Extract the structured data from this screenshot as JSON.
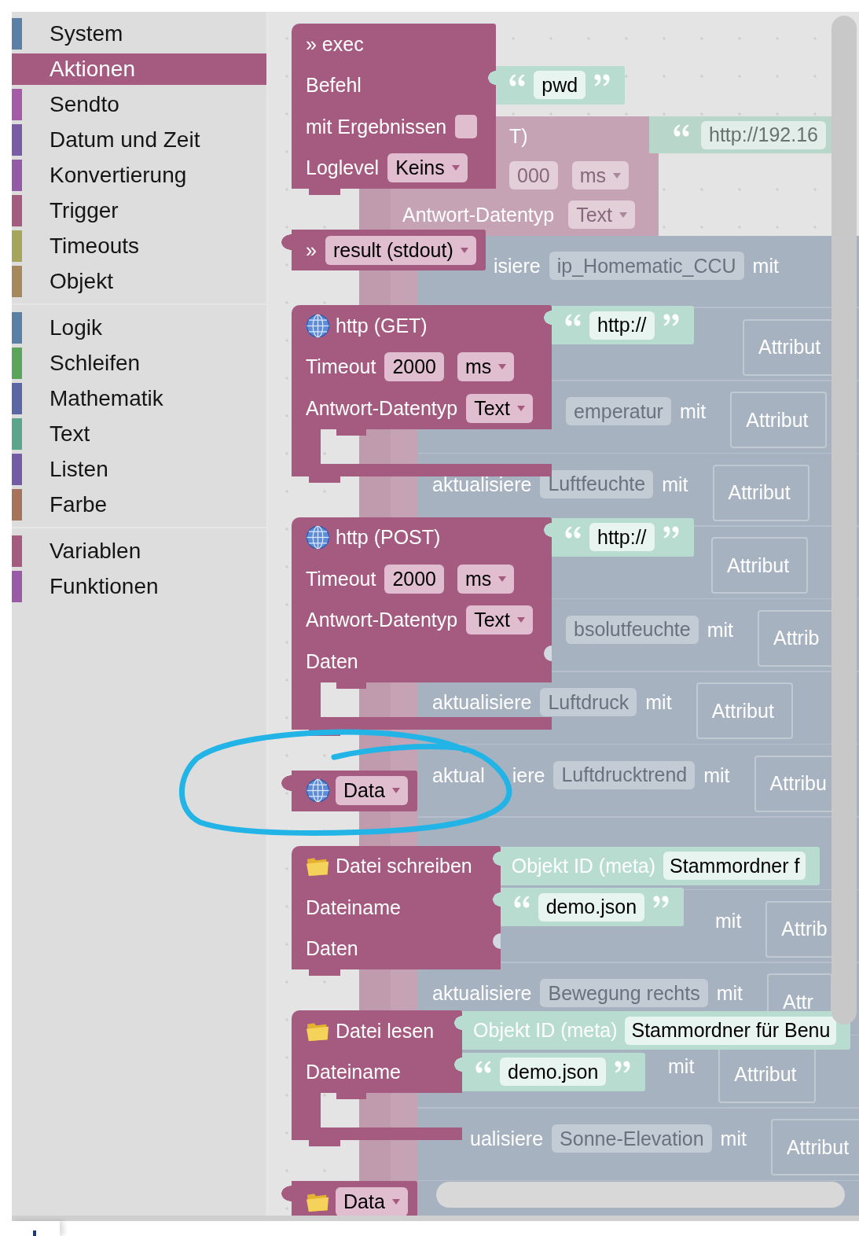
{
  "sidebar": {
    "groups": [
      {
        "items": [
          {
            "label": "System",
            "color": "#5b80a5",
            "selected": false
          },
          {
            "label": "Aktionen",
            "color": "#a55b80",
            "selected": true
          },
          {
            "label": "Sendto",
            "color": "#a55ba5",
            "selected": false
          },
          {
            "label": "Datum und Zeit",
            "color": "#7a5ba5",
            "selected": false
          },
          {
            "label": "Konvertierung",
            "color": "#935ba5",
            "selected": false
          },
          {
            "label": "Trigger",
            "color": "#a55b80",
            "selected": false
          },
          {
            "label": "Timeouts",
            "color": "#a5a55b",
            "selected": false
          },
          {
            "label": "Objekt",
            "color": "#a5885b",
            "selected": false
          }
        ]
      },
      {
        "items": [
          {
            "label": "Logik",
            "color": "#5b80a5",
            "selected": false
          },
          {
            "label": "Schleifen",
            "color": "#5ba55b",
            "selected": false
          },
          {
            "label": "Mathematik",
            "color": "#5b67a5",
            "selected": false
          },
          {
            "label": "Text",
            "color": "#5ba58c",
            "selected": false
          },
          {
            "label": "Listen",
            "color": "#745ba5",
            "selected": false
          },
          {
            "label": "Farbe",
            "color": "#a5745b",
            "selected": false
          }
        ]
      },
      {
        "items": [
          {
            "label": "Variablen",
            "color": "#a55b80",
            "selected": false
          },
          {
            "label": "Funktionen",
            "color": "#995ba5",
            "selected": false
          }
        ]
      }
    ]
  },
  "flyout": {
    "blocks": [
      {
        "kind": "command",
        "statement_input": false,
        "rows": [
          {
            "label": "» exec"
          },
          {
            "label": "Befehl",
            "input": {
              "kind": "text",
              "text": "pwd"
            }
          },
          {
            "label": "mit Ergebnissen",
            "checkbox": {
              "checked": false
            }
          },
          {
            "label": "Loglevel",
            "dropdown": "Keins"
          }
        ]
      },
      {
        "kind": "result",
        "statement_input": false,
        "rows": [
          {
            "label": "»",
            "dropdown": "result (stdout)"
          }
        ]
      },
      {
        "kind": "request",
        "statement_input": true,
        "rows": [
          {
            "label": "http (GET)",
            "input": {
              "kind": "text",
              "text": "http://"
            }
          },
          {
            "label": "Timeout",
            "field": "2000",
            "dropdown": "ms"
          },
          {
            "label": "Antwort-Datentyp",
            "dropdown": "Text"
          }
        ]
      },
      {
        "kind": "request",
        "statement_input": true,
        "rows": [
          {
            "label": "http (POST)",
            "input": {
              "kind": "text",
              "text": "http://"
            }
          },
          {
            "label": "Timeout",
            "field": "2000",
            "dropdown": "ms"
          },
          {
            "label": "Antwort-Datentyp",
            "dropdown": "Text"
          },
          {
            "label": "Daten",
            "input": {
              "kind": "empty"
            }
          }
        ]
      },
      {
        "kind": "response",
        "statement_input": false,
        "rows": [
          {
            "dropdown": "Data"
          }
        ]
      },
      {
        "kind": "file",
        "statement_input": false,
        "rows": [
          {
            "label": "Datei schreiben",
            "input": {
              "kind": "object_id",
              "label": "Objekt ID (meta)",
              "value": "Stammordner f"
            }
          },
          {
            "label": "Dateiname",
            "input": {
              "kind": "text",
              "text": "demo.json"
            }
          },
          {
            "label": "Daten",
            "input": {
              "kind": "empty"
            }
          }
        ]
      },
      {
        "kind": "file",
        "statement_input": true,
        "rows": [
          {
            "label": "Datei lesen",
            "input": {
              "kind": "object_id",
              "label": "Objekt ID (meta)",
              "value": "Stammordner für Benu"
            }
          },
          {
            "label": "Dateiname",
            "input": {
              "kind": "text",
              "text": "demo.json"
            }
          }
        ]
      },
      {
        "kind": "filedata",
        "statement_input": false,
        "rows": [
          {
            "dropdown": "Data"
          }
        ]
      }
    ]
  },
  "workspace": {
    "http_block": {
      "title": "T)",
      "timeout": "000",
      "unit": "ms",
      "type_label": "Antwort-Datentyp",
      "type": "Text",
      "url": "http://192.16"
    },
    "update_blocks": [
      {
        "label": "isiere",
        "object": "ip_Homematic_CCU",
        "connector": "mit"
      },
      {
        "attribute": "Attribut"
      },
      {
        "object": "emperatur",
        "connector": "mit",
        "attribute": "Attribut"
      },
      {
        "label": "aktualisiere",
        "object": "Luftfeuchte",
        "connector": "mit",
        "attribute": "Attribut"
      },
      {
        "attribute": "Attribut"
      },
      {
        "object": "bsolutfeuchte",
        "connector": "mit",
        "attribute": "Attrib"
      },
      {
        "label": "aktualisiere",
        "object": "Luftdruck",
        "connector": "mit",
        "attribute": "Attribut"
      },
      {
        "label_parts": [
          "aktual",
          "iere"
        ],
        "object": "Luftdrucktrend",
        "connector": "mit",
        "attribute": "Attribu"
      },
      {
        "connector": "mit",
        "attribute": "Attrib"
      },
      {
        "label": "aktualisiere",
        "object": "Bewegung rechts",
        "connector": "mit",
        "attribute": "Attr"
      },
      {
        "connector": "mit",
        "attribute": "Attribut"
      },
      {
        "label": "ualisiere",
        "object": "Sonne-Elevation",
        "connector": "mit",
        "attribute": "Attribut"
      }
    ]
  }
}
